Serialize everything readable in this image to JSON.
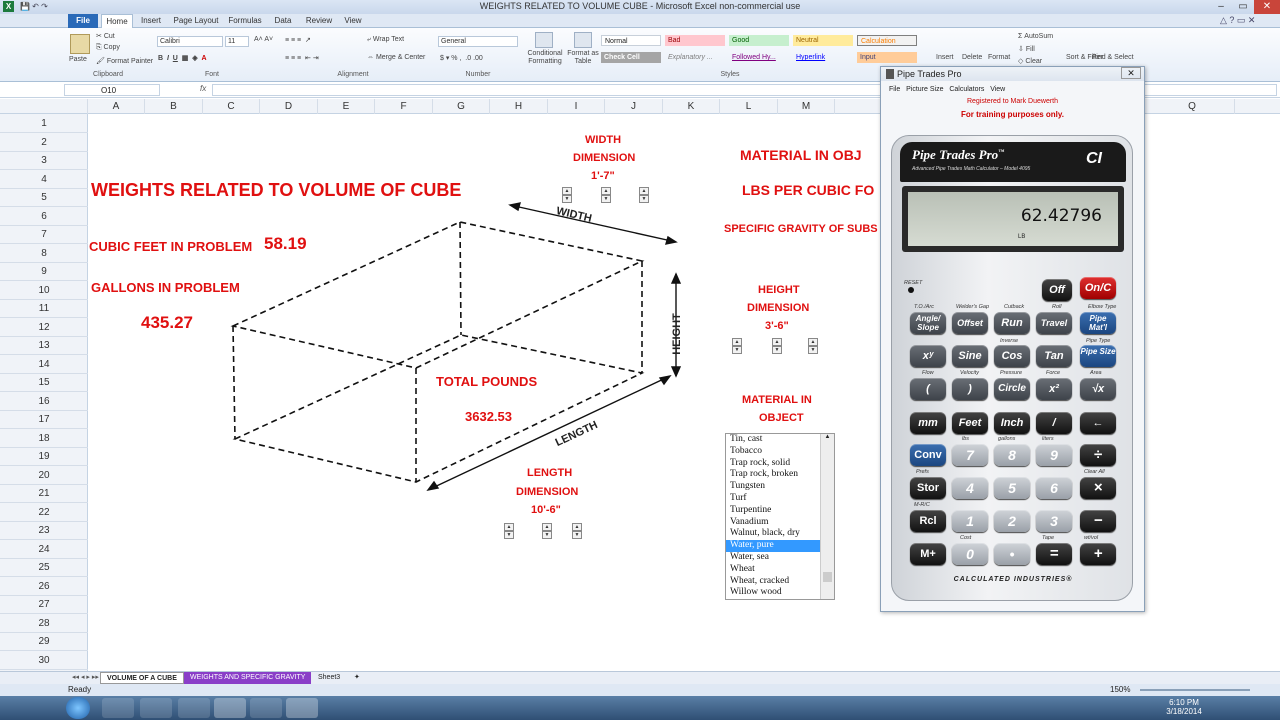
{
  "window": {
    "title": "WEIGHTS RELATED TO VOLUME CUBE  -  Microsoft Excel non-commercial use"
  },
  "ribbon": {
    "tabs": [
      "File",
      "Home",
      "Insert",
      "Page Layout",
      "Formulas",
      "Data",
      "Review",
      "View"
    ],
    "clipboard": {
      "paste": "Paste",
      "cut": "Cut",
      "copy": "Copy",
      "format_painter": "Format Painter",
      "label": "Clipboard"
    },
    "font": {
      "name": "Calibri",
      "size": "11",
      "label": "Font"
    },
    "alignment": {
      "wrap": "Wrap Text",
      "merge": "Merge & Center",
      "label": "Alignment"
    },
    "number": {
      "format": "General",
      "label": "Number"
    },
    "styles": {
      "conditional": "Conditional Formatting",
      "format_table": "Format as Table",
      "cells": [
        "Normal",
        "Bad",
        "Good",
        "Neutral",
        "Calculation",
        "Check Cell",
        "Explanatory ...",
        "Followed Hy...",
        "Hyperlink",
        "Input"
      ],
      "label": "Styles"
    },
    "cells": {
      "insert": "Insert",
      "delete": "Delete",
      "format": "Format"
    },
    "editing": {
      "autosum": "AutoSum",
      "fill": "Fill",
      "clear": "Clear",
      "sort": "Sort & Filter",
      "find": "Find & Select"
    }
  },
  "formula_bar": {
    "name_box": "O10",
    "fx": "fx",
    "value": ""
  },
  "columns": [
    "A",
    "B",
    "C",
    "D",
    "E",
    "F",
    "G",
    "H",
    "I",
    "J",
    "K",
    "L",
    "M",
    "Q"
  ],
  "rows": [
    "1",
    "2",
    "3",
    "4",
    "5",
    "6",
    "7",
    "8",
    "9",
    "10",
    "11",
    "12",
    "13",
    "14",
    "15",
    "16",
    "17",
    "18",
    "19",
    "20",
    "21",
    "22",
    "23",
    "24",
    "25",
    "26",
    "27",
    "28",
    "29",
    "30"
  ],
  "sheet": {
    "heading": "WEIGHTS RELATED TO VOLUME OF CUBE",
    "cubic_feet_label": "CUBIC FEET IN PROBLEM",
    "cubic_feet_value": "58.19",
    "gallons_label": "GALLONS IN PROBLEM",
    "gallons_value": "435.27",
    "total_pounds_label": "TOTAL POUNDS",
    "total_pounds_value": "3632.53",
    "width_label_1": "WIDTH",
    "width_label_2": "DIMENSION",
    "width_value": "1'-7\"",
    "height_label_1": "HEIGHT",
    "height_label_2": "DIMENSION",
    "height_value": "3'-6\"",
    "length_label_1": "LENGTH",
    "length_label_2": "DIMENSION",
    "length_value": "10'-6\"",
    "cube_width": "WIDTH",
    "cube_height": "HEIGHT",
    "cube_length": "LENGTH",
    "material_in_object": "MATERIAL IN OBJ",
    "lbs_per_cubic": "LBS PER CUBIC FO",
    "specific_gravity": "SPECIFIC GRAVITY OF SUBS",
    "material_label_1": "MATERIAL IN",
    "material_label_2": "OBJECT"
  },
  "materials": [
    "Tin, cast",
    "Tobacco",
    "Trap rock, solid",
    "Trap rock, broken",
    "Tungsten",
    "Turf",
    "Turpentine",
    "Vanadium",
    "Walnut, black, dry",
    "Water, pure",
    "Water, sea",
    "Wheat",
    "Wheat, cracked",
    "Willow wood"
  ],
  "selected_material": "Water, pure",
  "sheet_tabs": [
    "VOLUME OF A CUBE",
    "WEIGHTS AND SPECIFIC GRAVITY",
    "Sheet3"
  ],
  "status": {
    "ready": "Ready",
    "zoom": "150%"
  },
  "taskbar": {
    "time": "6:10 PM",
    "date": "3/18/2014"
  },
  "calculator": {
    "window_title": "Pipe Trades Pro",
    "menu": [
      "File",
      "Picture Size",
      "Calculators",
      "View"
    ],
    "registered": "Registered to Mark Duewerth",
    "training": "For training purposes only.",
    "brand": "Pipe Trades Pro",
    "tm": "™",
    "subtitle": "Advanced Pipe Trades Math Calculator – Model 4095",
    "logo": "CI",
    "display_value": "62.42796",
    "display_unit": "LB",
    "reset": "RESET",
    "maker": "CALCULATED INDUSTRIES®",
    "keys": {
      "off": "Off",
      "onc": "On/C",
      "angle": "Angle/ Slope",
      "offset": "Offset",
      "run": "Run",
      "travel": "Travel",
      "pipe_matl": "Pipe Mat'l",
      "xy": "xʸ",
      "sine": "Sine",
      "cos": "Cos",
      "tan": "Tan",
      "pipe_size": "Pipe Size",
      "lparen": "(",
      "rparen": ")",
      "circle": "Circle",
      "x2": "x²",
      "sqrt": "√x",
      "mm": "mm",
      "feet": "Feet",
      "inch": "Inch",
      "slash": "/",
      "back": "←",
      "conv": "Conv",
      "k7": "7",
      "k8": "8",
      "k9": "9",
      "div": "÷",
      "stor": "Stor",
      "k4": "4",
      "k5": "5",
      "k6": "6",
      "mul": "×",
      "rcl": "Rcl",
      "k1": "1",
      "k2": "2",
      "k3": "3",
      "minus": "−",
      "mplus": "M+",
      "k0": "0",
      "dot": "•",
      "eq": "=",
      "plus": "+"
    },
    "labels": {
      "to_arc": "T.O./Arc",
      "welders_gap": "Welder's Gap",
      "cutback": "Cutback",
      "roll": "Roll",
      "elbow_type": "Elbow Type",
      "inverse": "Inverse",
      "pipe_type": "Pipe Type",
      "flow": "Flow",
      "velocity": "Velocity",
      "pressure": "Pressure",
      "force": "Force",
      "area": "Area",
      "lbs": "lbs",
      "gallons": "gallons",
      "liters": "liters",
      "prefs": "Prefs",
      "clear_all": "Clear All",
      "mrc": "M-R/C",
      "cost": "Cost",
      "tape": "Tape",
      "wvol": "wt/vol"
    }
  }
}
